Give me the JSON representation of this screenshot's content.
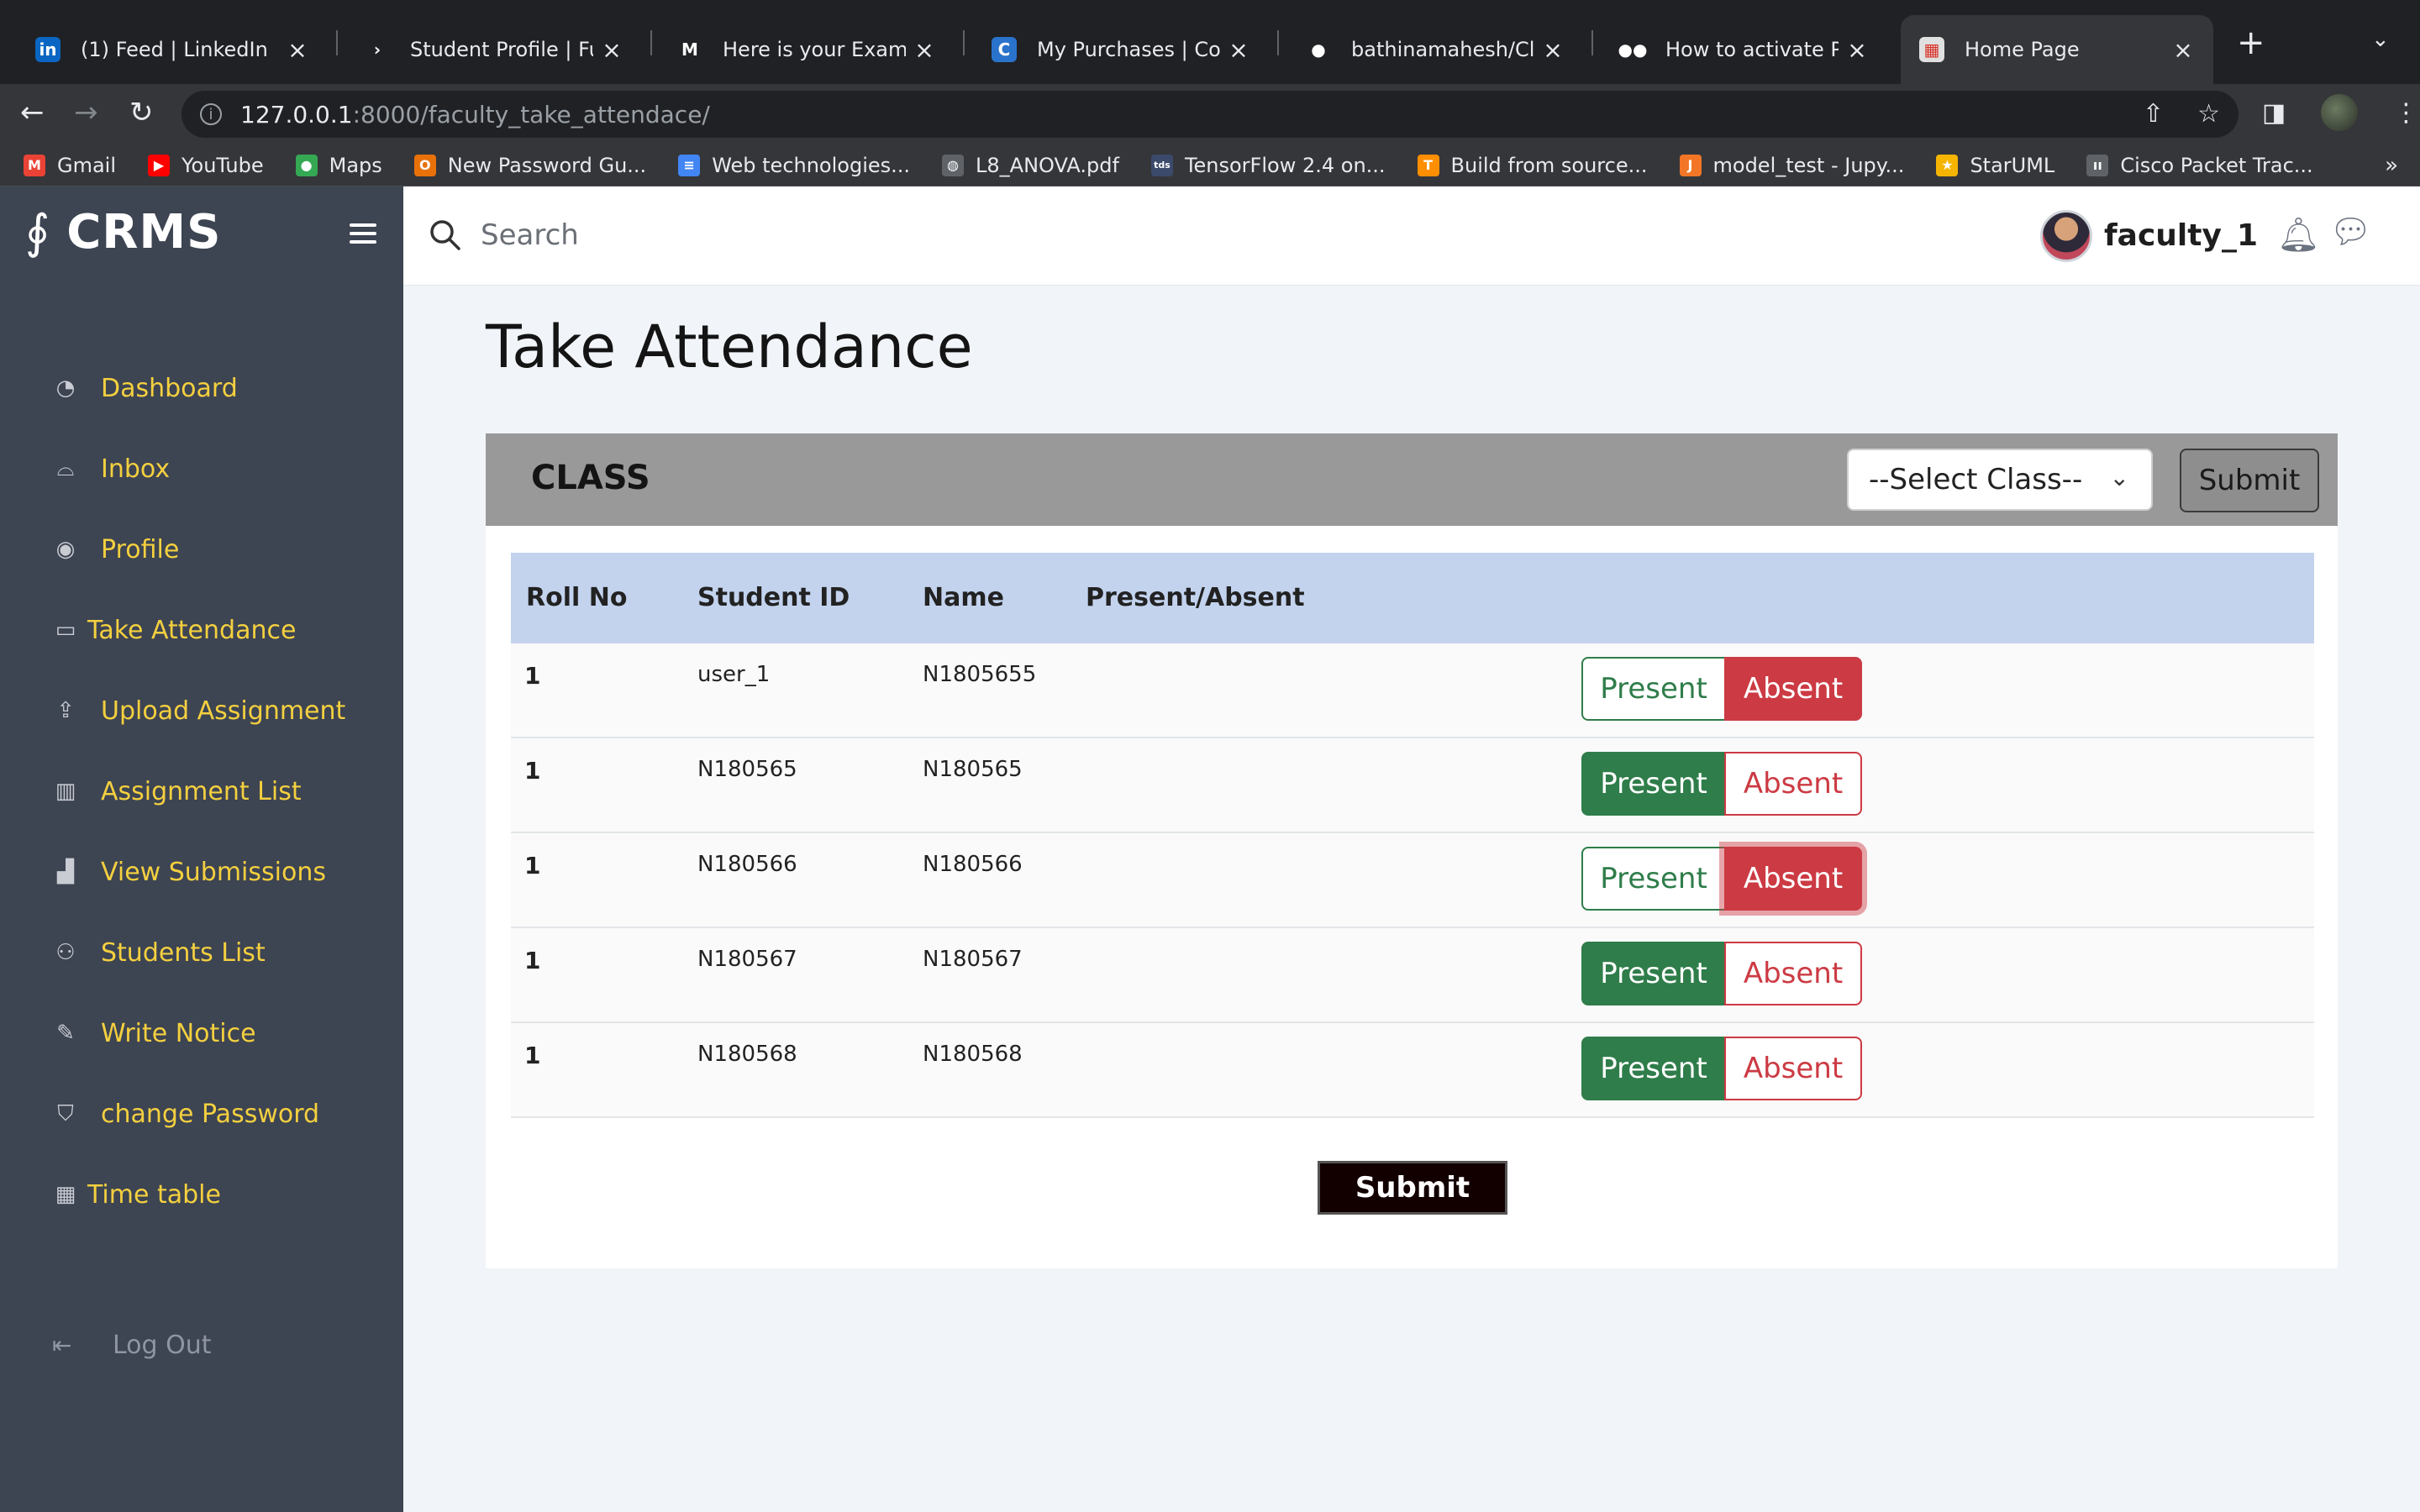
{
  "browser": {
    "tabs": [
      {
        "title": "(1) Feed | LinkedIn",
        "icon": "linkedin-icon",
        "color": "#0a66c2",
        "glyph": "in"
      },
      {
        "title": "Student Profile | Futur",
        "icon": "futurense-icon",
        "color": "#202124",
        "glyph": "›"
      },
      {
        "title": "Here is your Exam Vo",
        "icon": "gmail-icon",
        "color": "#202124",
        "glyph": "M"
      },
      {
        "title": "My Purchases | Cours",
        "icon": "coursera-icon",
        "color": "#2a73cc",
        "glyph": "C"
      },
      {
        "title": "bathinamahesh/Class",
        "icon": "github-icon",
        "color": "#202124",
        "glyph": "●"
      },
      {
        "title": "How to activate Pytho",
        "icon": "medium-icon",
        "color": "#202124",
        "glyph": "●●"
      },
      {
        "title": "Home Page",
        "icon": "calendar-icon",
        "color": "#e0e0e0",
        "glyph": "▦"
      }
    ],
    "url_host": "127.0.0.1",
    "url_path": ":8000/faculty_take_attendace/",
    "bookmarks": [
      {
        "label": "Gmail",
        "icon": "gmail-icon",
        "color": "#ea4335",
        "glyph": "M"
      },
      {
        "label": "YouTube",
        "icon": "youtube-icon",
        "color": "#ff0000",
        "glyph": "▶"
      },
      {
        "label": "Maps",
        "icon": "maps-icon",
        "color": "#34a853",
        "glyph": "●"
      },
      {
        "label": "New Password Gu...",
        "icon": "password-icon",
        "color": "#e8710a",
        "glyph": "O"
      },
      {
        "label": "Web technologies...",
        "icon": "docs-icon",
        "color": "#4285f4",
        "glyph": "≡"
      },
      {
        "label": "L8_ANOVA.pdf",
        "icon": "globe-icon",
        "color": "#5f6368",
        "glyph": "◍"
      },
      {
        "label": "TensorFlow 2.4 on...",
        "icon": "tds-icon",
        "color": "#3b4a6b",
        "glyph": "tds"
      },
      {
        "label": "Build from source...",
        "icon": "tensorflow-icon",
        "color": "#ff8f00",
        "glyph": "T"
      },
      {
        "label": "model_test - Jupy...",
        "icon": "jupyter-icon",
        "color": "#f37626",
        "glyph": "J"
      },
      {
        "label": "StarUML",
        "icon": "staruml-icon",
        "color": "#f4b400",
        "glyph": "★"
      },
      {
        "label": "Cisco Packet Trac...",
        "icon": "cisco-icon",
        "color": "#5f6368",
        "glyph": "ıı"
      }
    ]
  },
  "app": {
    "brand": "CRMS",
    "search_placeholder": "Search",
    "user": "faculty_1",
    "page_title": "Take Attendance",
    "nav": [
      {
        "label": "Dashboard",
        "icon": "dashboard-icon",
        "glyph": "◔"
      },
      {
        "label": "Inbox",
        "icon": "inbox-icon",
        "glyph": "⌓"
      },
      {
        "label": "Profile",
        "icon": "profile-icon",
        "glyph": "◉"
      },
      {
        "label": "Take Attendance",
        "icon": "attendance-icon",
        "glyph": "▭"
      },
      {
        "label": "Upload Assignment",
        "icon": "upload-icon",
        "glyph": "⇪"
      },
      {
        "label": "Assignment List",
        "icon": "book-icon",
        "glyph": "▥"
      },
      {
        "label": "View Submissions",
        "icon": "bar-chart-icon",
        "glyph": "▟"
      },
      {
        "label": "Students List",
        "icon": "users-icon",
        "glyph": "⚇"
      },
      {
        "label": "Write Notice",
        "icon": "edit-icon",
        "glyph": "✎"
      },
      {
        "label": "change Password",
        "icon": "shield-icon",
        "glyph": "⛉"
      },
      {
        "label": "Time table",
        "icon": "grid-icon",
        "glyph": "▦"
      }
    ],
    "logout": "Log Out",
    "class_label": "CLASS",
    "class_select": "--Select Class--",
    "header_submit": "Submit",
    "table": {
      "headers": [
        "Roll No",
        "Student ID",
        "Name",
        "Present/Absent"
      ],
      "rows": [
        {
          "roll": "1",
          "student_id": "user_1",
          "name": "N1805655",
          "status": "absent"
        },
        {
          "roll": "1",
          "student_id": "N180565",
          "name": "N180565",
          "status": "present"
        },
        {
          "roll": "1",
          "student_id": "N180566",
          "name": "N180566",
          "status": "absent"
        },
        {
          "roll": "1",
          "student_id": "N180567",
          "name": "N180567",
          "status": "present"
        },
        {
          "roll": "1",
          "student_id": "N180568",
          "name": "N180568",
          "status": "present"
        }
      ],
      "present_label": "Present",
      "absent_label": "Absent"
    },
    "submit": "Submit"
  }
}
